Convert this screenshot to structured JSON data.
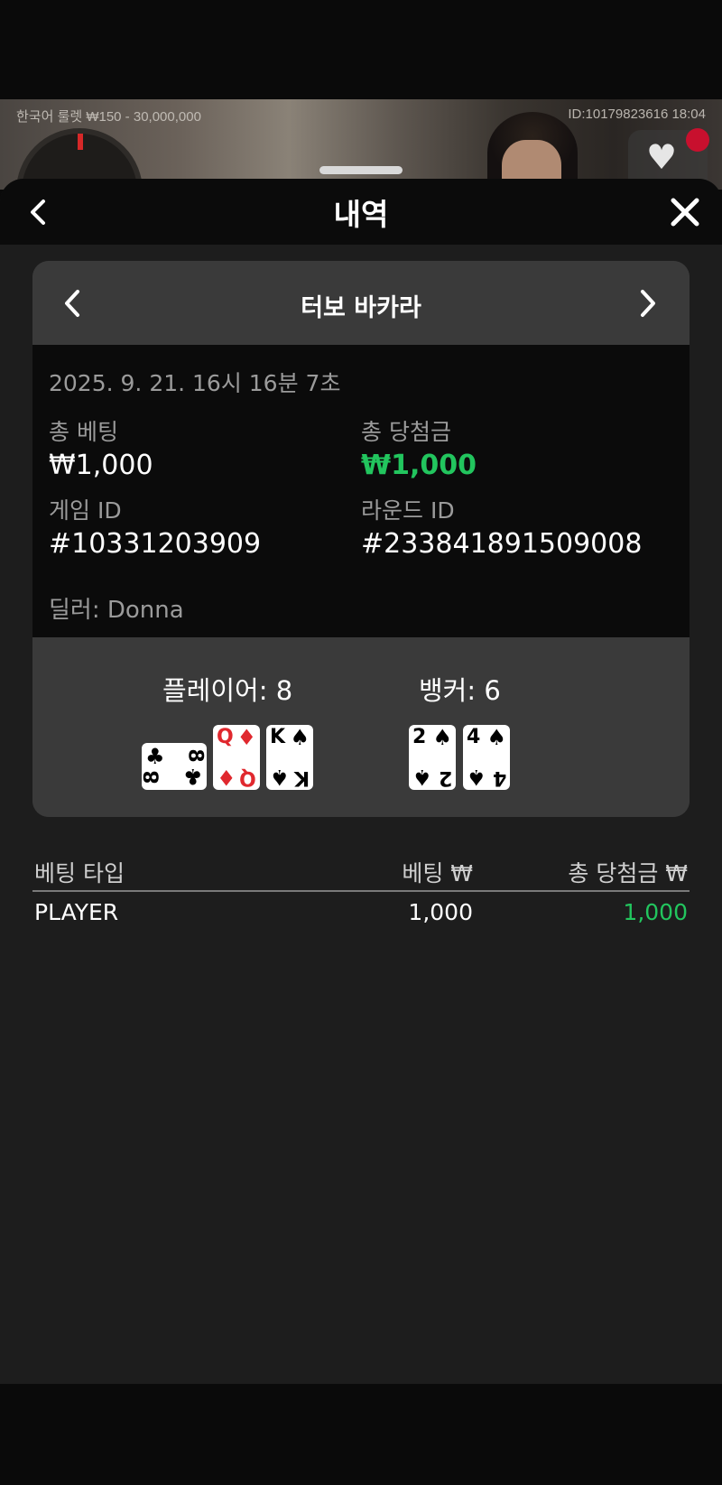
{
  "video": {
    "game_info": "한국어 룰렛  ₩150 - 30,000,000",
    "session_info": "ID:10179823616  18:04"
  },
  "header": {
    "title": "내역",
    "back_icon": "chevron-left-icon",
    "close_icon": "close-icon"
  },
  "game_panel": {
    "title": "터보 바카라",
    "date": "2025. 9. 21. 16시 16분 7초",
    "total_bet_label": "총 베팅",
    "total_bet_value": "₩1,000",
    "total_win_label": "총 당첨금",
    "total_win_value": "₩1,000",
    "game_id_label": "게임 ID",
    "game_id_value": "#10331203909",
    "round_id_label": "라운드 ID",
    "round_id_value": "#233841891509008",
    "dealer": "딜러: Donna"
  },
  "result": {
    "player_label": "플레이어: 8",
    "banker_label": "뱅커: 6",
    "player_cards": [
      {
        "rank": "8",
        "suit": "♣",
        "color": "black",
        "sideways": true
      },
      {
        "rank": "Q",
        "suit": "♦",
        "color": "red",
        "sideways": false
      },
      {
        "rank": "K",
        "suit": "♠",
        "color": "black",
        "sideways": false
      }
    ],
    "banker_cards": [
      {
        "rank": "2",
        "suit": "♠",
        "color": "black",
        "sideways": false
      },
      {
        "rank": "4",
        "suit": "♠",
        "color": "black",
        "sideways": false
      }
    ]
  },
  "bet_table": {
    "headers": [
      "베팅 타입",
      "베팅 ₩",
      "총 당첨금 ₩"
    ],
    "rows": [
      {
        "type": "PLAYER",
        "bet": "1,000",
        "win": "1,000"
      }
    ]
  },
  "colors": {
    "win_green": "#22c55e",
    "sheet_bg": "#1d1d1d",
    "panel_gray": "#3a3a3a",
    "header_black": "#0b0b0b"
  }
}
